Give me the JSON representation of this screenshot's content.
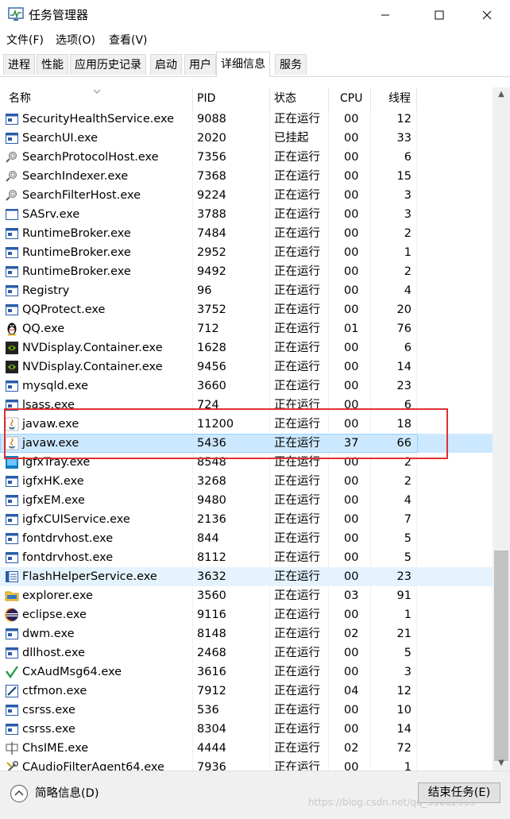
{
  "window": {
    "title": "任务管理器",
    "minimize_glyph": "—",
    "maximize_glyph": "☐",
    "close_glyph": "✕"
  },
  "menu": [
    "文件(F)",
    "选项(O)",
    "查看(V)"
  ],
  "tabs": [
    "进程",
    "性能",
    "应用历史记录",
    "启动",
    "用户",
    "详细信息",
    "服务"
  ],
  "active_tab_index": 5,
  "columns": {
    "name": "名称",
    "pid": "PID",
    "status": "状态",
    "cpu": "CPU",
    "threads": "线程"
  },
  "processes": [
    {
      "name": "SecurityHealthService.exe",
      "pid": "9088",
      "status": "正在运行",
      "cpu": "00",
      "threads": "12",
      "icon": "window-icon"
    },
    {
      "name": "SearchUI.exe",
      "pid": "2020",
      "status": "已挂起",
      "cpu": "00",
      "threads": "33",
      "icon": "window-icon"
    },
    {
      "name": "SearchProtocolHost.exe",
      "pid": "7356",
      "status": "正在运行",
      "cpu": "00",
      "threads": "6",
      "icon": "search-service-icon"
    },
    {
      "name": "SearchIndexer.exe",
      "pid": "7368",
      "status": "正在运行",
      "cpu": "00",
      "threads": "15",
      "icon": "search-service-icon"
    },
    {
      "name": "SearchFilterHost.exe",
      "pid": "9224",
      "status": "正在运行",
      "cpu": "00",
      "threads": "3",
      "icon": "search-service-icon"
    },
    {
      "name": "SASrv.exe",
      "pid": "3788",
      "status": "正在运行",
      "cpu": "00",
      "threads": "3",
      "icon": "blank-window-icon"
    },
    {
      "name": "RuntimeBroker.exe",
      "pid": "7484",
      "status": "正在运行",
      "cpu": "00",
      "threads": "2",
      "icon": "window-icon"
    },
    {
      "name": "RuntimeBroker.exe",
      "pid": "2952",
      "status": "正在运行",
      "cpu": "00",
      "threads": "1",
      "icon": "window-icon"
    },
    {
      "name": "RuntimeBroker.exe",
      "pid": "9492",
      "status": "正在运行",
      "cpu": "00",
      "threads": "2",
      "icon": "window-icon"
    },
    {
      "name": "Registry",
      "pid": "96",
      "status": "正在运行",
      "cpu": "00",
      "threads": "4",
      "icon": "window-icon"
    },
    {
      "name": "QQProtect.exe",
      "pid": "3752",
      "status": "正在运行",
      "cpu": "00",
      "threads": "20",
      "icon": "window-icon"
    },
    {
      "name": "QQ.exe",
      "pid": "712",
      "status": "正在运行",
      "cpu": "01",
      "threads": "76",
      "icon": "penguin-icon"
    },
    {
      "name": "NVDisplay.Container.exe",
      "pid": "1628",
      "status": "正在运行",
      "cpu": "00",
      "threads": "6",
      "icon": "nvidia-icon"
    },
    {
      "name": "NVDisplay.Container.exe",
      "pid": "9456",
      "status": "正在运行",
      "cpu": "00",
      "threads": "14",
      "icon": "nvidia-icon"
    },
    {
      "name": "mysqld.exe",
      "pid": "3660",
      "status": "正在运行",
      "cpu": "00",
      "threads": "23",
      "icon": "window-icon"
    },
    {
      "name": "lsass.exe",
      "pid": "724",
      "status": "正在运行",
      "cpu": "00",
      "threads": "6",
      "icon": "window-icon"
    },
    {
      "name": "javaw.exe",
      "pid": "11200",
      "status": "正在运行",
      "cpu": "00",
      "threads": "18",
      "icon": "java-icon"
    },
    {
      "name": "javaw.exe",
      "pid": "5436",
      "status": "正在运行",
      "cpu": "37",
      "threads": "66",
      "icon": "java-icon"
    },
    {
      "name": "igfxTray.exe",
      "pid": "8548",
      "status": "正在运行",
      "cpu": "00",
      "threads": "2",
      "icon": "intel-tray-icon"
    },
    {
      "name": "igfxHK.exe",
      "pid": "3268",
      "status": "正在运行",
      "cpu": "00",
      "threads": "2",
      "icon": "window-icon"
    },
    {
      "name": "igfxEM.exe",
      "pid": "9480",
      "status": "正在运行",
      "cpu": "00",
      "threads": "4",
      "icon": "window-icon"
    },
    {
      "name": "igfxCUIService.exe",
      "pid": "2136",
      "status": "正在运行",
      "cpu": "00",
      "threads": "7",
      "icon": "window-icon"
    },
    {
      "name": "fontdrvhost.exe",
      "pid": "844",
      "status": "正在运行",
      "cpu": "00",
      "threads": "5",
      "icon": "window-icon"
    },
    {
      "name": "fontdrvhost.exe",
      "pid": "8112",
      "status": "正在运行",
      "cpu": "00",
      "threads": "5",
      "icon": "window-icon"
    },
    {
      "name": "FlashHelperService.exe",
      "pid": "3632",
      "status": "正在运行",
      "cpu": "00",
      "threads": "23",
      "icon": "flash-window-icon"
    },
    {
      "name": "explorer.exe",
      "pid": "3560",
      "status": "正在运行",
      "cpu": "03",
      "threads": "91",
      "icon": "folder-icon"
    },
    {
      "name": "eclipse.exe",
      "pid": "9116",
      "status": "正在运行",
      "cpu": "00",
      "threads": "1",
      "icon": "eclipse-icon"
    },
    {
      "name": "dwm.exe",
      "pid": "8148",
      "status": "正在运行",
      "cpu": "02",
      "threads": "21",
      "icon": "window-icon"
    },
    {
      "name": "dllhost.exe",
      "pid": "2468",
      "status": "正在运行",
      "cpu": "00",
      "threads": "5",
      "icon": "window-icon"
    },
    {
      "name": "CxAudMsg64.exe",
      "pid": "3616",
      "status": "正在运行",
      "cpu": "00",
      "threads": "3",
      "icon": "check-icon"
    },
    {
      "name": "ctfmon.exe",
      "pid": "7912",
      "status": "正在运行",
      "cpu": "04",
      "threads": "12",
      "icon": "pen-icon"
    },
    {
      "name": "csrss.exe",
      "pid": "536",
      "status": "正在运行",
      "cpu": "00",
      "threads": "10",
      "icon": "window-icon"
    },
    {
      "name": "csrss.exe",
      "pid": "8304",
      "status": "正在运行",
      "cpu": "00",
      "threads": "14",
      "icon": "window-icon"
    },
    {
      "name": "ChsIME.exe",
      "pid": "4444",
      "status": "正在运行",
      "cpu": "02",
      "threads": "72",
      "icon": "ime-icon"
    },
    {
      "name": "CAudioFilterAgent64.exe",
      "pid": "7936",
      "status": "正在运行",
      "cpu": "00",
      "threads": "1",
      "icon": "tools-icon"
    }
  ],
  "selected_row_index": 17,
  "hover_row_index": 24,
  "footer": {
    "less_details": "简略信息(D)",
    "end_task": "结束任务(E)"
  },
  "watermark": "https://blog.csdn.net/qq_35002939",
  "colors": {
    "selection": "#cce8ff",
    "hover": "#e5f3ff",
    "highlight_box": "#e03030"
  }
}
